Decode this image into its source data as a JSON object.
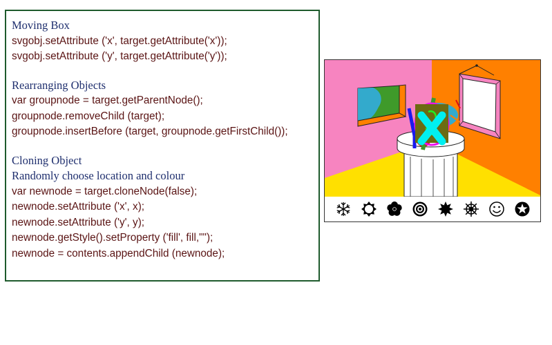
{
  "code_panel": {
    "sections": [
      {
        "heading": "Moving Box",
        "lines": [
          "svgobj.setAttribute ('x', target.getAttribute('x'));",
          "svgobj.setAttribute ('y', target.getAttribute('y'));"
        ]
      },
      {
        "heading": "Rearranging Objects",
        "lines": [
          "var groupnode = target.getParentNode();",
          "groupnode.removeChild (target);",
          "groupnode.insertBefore (target, groupnode.getFirstChild());"
        ]
      },
      {
        "heading": "Cloning Object",
        "subheading": "Randomly choose location and colour",
        "lines": [
          "var newnode = target.cloneNode(false);",
          "newnode.setAttribute ('x', x);",
          "newnode.setAttribute ('y', y);",
          "newnode.getStyle().setProperty ('fill', fill,\"\");",
          "newnode = contents.appendChild (newnode);"
        ]
      }
    ]
  },
  "scene": {
    "colors": {
      "left_wall": "#f784c0",
      "right_wall": "#ff8000",
      "floor": "#ffe000",
      "window_sky": "#33aacc",
      "window_land": "#3f9a2a",
      "window_sill": "#ff8000",
      "frame": "#f784c0",
      "pedestal": "#ffffff"
    },
    "toolbar_icons": [
      {
        "name": "snowflake-icon",
        "label": "snowflake"
      },
      {
        "name": "sun-icon",
        "label": "sun"
      },
      {
        "name": "flower-icon",
        "label": "flower"
      },
      {
        "name": "target-icon",
        "label": "target"
      },
      {
        "name": "starburst-icon",
        "label": "starburst"
      },
      {
        "name": "ship-wheel-icon",
        "label": "ship wheel"
      },
      {
        "name": "smiley-icon",
        "label": "smiley face"
      },
      {
        "name": "star-circle-icon",
        "label": "star in circle"
      }
    ]
  }
}
